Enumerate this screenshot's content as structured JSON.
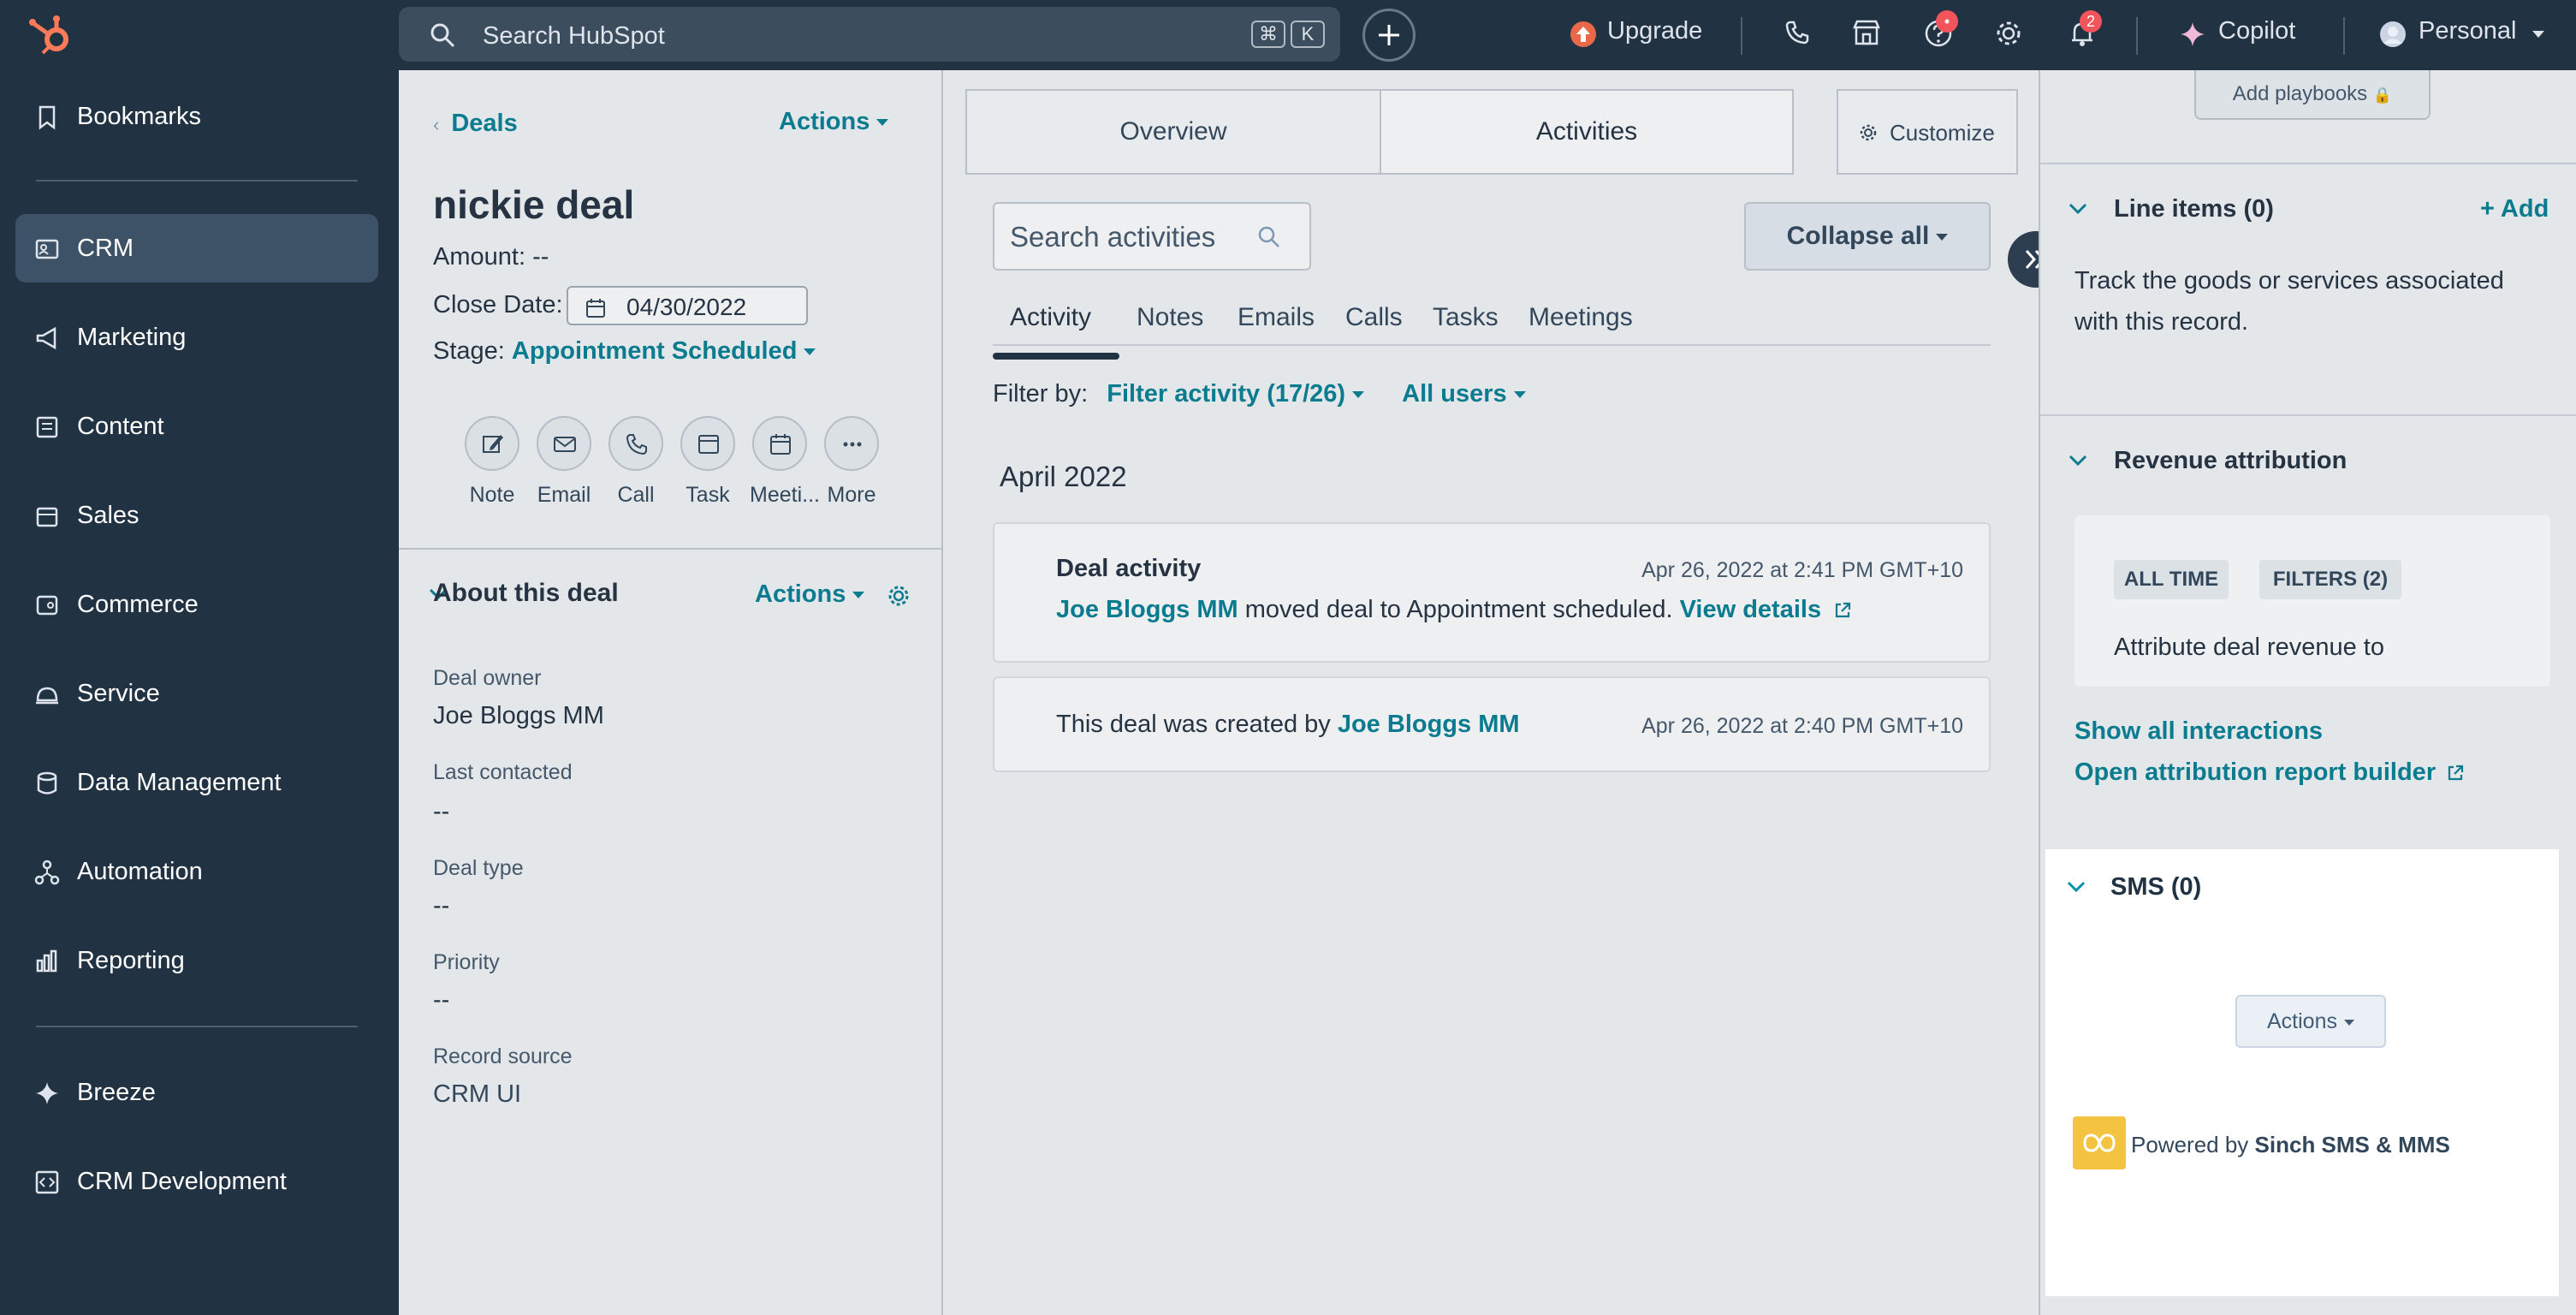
{
  "topnav": {
    "search_placeholder": "Search HubSpot",
    "kbd_cmd": "⌘",
    "kbd_k": "K",
    "upgrade": "Upgrade",
    "copilot": "Copilot",
    "account": "Personal",
    "help_badge": "•",
    "notifications_badge": "2"
  },
  "sidebar": {
    "items": [
      {
        "label": "Bookmarks",
        "icon": "bookmark-icon"
      },
      {
        "label": "CRM",
        "icon": "crm-icon"
      },
      {
        "label": "Marketing",
        "icon": "megaphone-icon"
      },
      {
        "label": "Content",
        "icon": "content-icon"
      },
      {
        "label": "Sales",
        "icon": "sales-icon"
      },
      {
        "label": "Commerce",
        "icon": "commerce-icon"
      },
      {
        "label": "Service",
        "icon": "service-icon"
      },
      {
        "label": "Data Management",
        "icon": "database-icon"
      },
      {
        "label": "Automation",
        "icon": "automation-icon"
      },
      {
        "label": "Reporting",
        "icon": "reporting-icon"
      },
      {
        "label": "Breeze",
        "icon": "sparkle-icon"
      },
      {
        "label": "CRM Development",
        "icon": "code-icon"
      }
    ]
  },
  "deal": {
    "breadcrumb": "Deals",
    "actions": "Actions",
    "title": "nickie deal",
    "amount_label": "Amount:",
    "amount_value": "--",
    "close_label": "Close Date:",
    "close_value": "04/30/2022",
    "stage_label": "Stage:",
    "stage_value": "Appointment Scheduled",
    "quick_actions": [
      "Note",
      "Email",
      "Call",
      "Task",
      "Meeti...",
      "More"
    ],
    "about_title": "About this deal",
    "about_actions": "Actions",
    "fields": [
      {
        "label": "Deal owner",
        "value": "Joe Bloggs MM"
      },
      {
        "label": "Last contacted",
        "value": "--"
      },
      {
        "label": "Deal type",
        "value": "--"
      },
      {
        "label": "Priority",
        "value": "--"
      },
      {
        "label": "Record source",
        "value": "CRM UI"
      }
    ]
  },
  "middle": {
    "tabs": [
      "Overview",
      "Activities"
    ],
    "customize": "Customize",
    "search_placeholder": "Search activities",
    "collapse_all": "Collapse all",
    "subtabs": [
      "Activity",
      "Notes",
      "Emails",
      "Calls",
      "Tasks",
      "Meetings"
    ],
    "filter_by": "Filter by:",
    "filter_activity": "Filter activity (17/26)",
    "all_users": "All users",
    "month": "April 2022",
    "card1": {
      "title": "Deal activity",
      "timestamp": "Apr 26, 2022 at 2:41 PM GMT+10",
      "actor": "Joe Bloggs MM",
      "text": "moved deal to Appointment scheduled.",
      "link": "View details"
    },
    "card2": {
      "text": "This deal was created by",
      "actor": "Joe Bloggs MM",
      "timestamp": "Apr 26, 2022 at 2:40 PM GMT+10"
    }
  },
  "right": {
    "add_playbooks": "Add playbooks",
    "line_items_title": "Line items (0)",
    "line_items_add": "+ Add",
    "line_items_desc_1": "Track the goods or services associated",
    "line_items_desc_2": "with this record.",
    "revenue_title": "Revenue attribution",
    "pill_all_time": "ALL TIME",
    "pill_filters": "FILTERS (2)",
    "attr_text": "Attribute deal revenue to",
    "show_all": "Show all interactions",
    "open_builder": "Open attribution report builder",
    "sms_title": "SMS (0)",
    "sms_actions": "Actions",
    "powered_by": "Powered by",
    "sinch": "Sinch SMS & MMS"
  },
  "colors": {
    "nav_bg": "#213343",
    "accent_teal": "#0b7b8f",
    "hubspot_orange": "#ff7a59",
    "badge_red": "#f2545b",
    "sinch_yellow": "#f5c342"
  }
}
